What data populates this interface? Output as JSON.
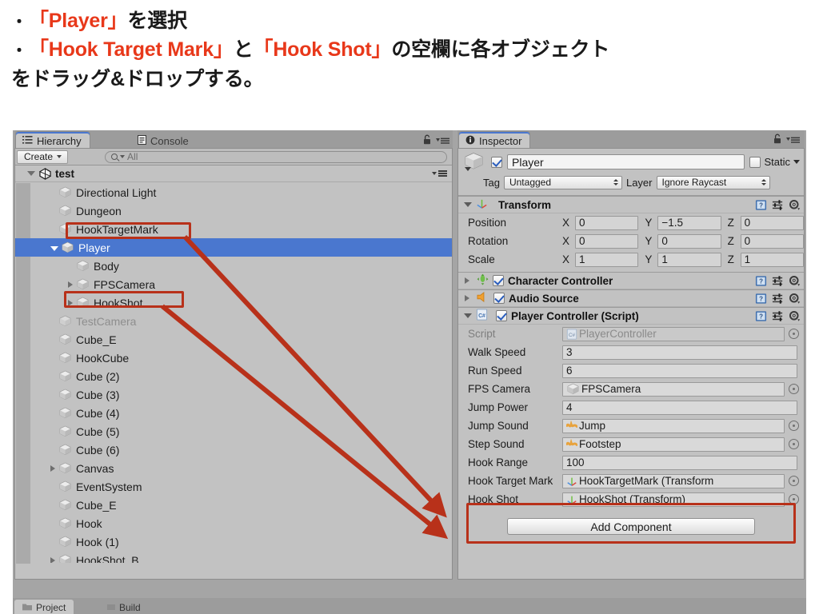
{
  "caption": {
    "line1_bullet": "・",
    "line1_a": "「Player」",
    "line1_b": "を選択",
    "line2_bullet": "・",
    "line2_a": "「Hook Target Mark」",
    "line2_b": "と",
    "line2_c": "「Hook Shot」",
    "line2_d": "の空欄に各オブジェクト",
    "line3": "をドラッグ&ドロップする。",
    "accent_color": "#e8381a"
  },
  "hierarchy": {
    "tabs": [
      {
        "label": "Hierarchy",
        "icon": "list-icon",
        "active": true
      },
      {
        "label": "Console",
        "icon": "console-icon",
        "active": false
      }
    ],
    "toolbar": {
      "create_label": "Create",
      "search_placeholder": "All",
      "search_value": ""
    },
    "scene": {
      "name": "test",
      "expanded": true
    },
    "items": [
      {
        "label": "Directional Light",
        "depth": 1,
        "foldout": "none",
        "selected": false,
        "dim": false,
        "highlight": false
      },
      {
        "label": "Dungeon",
        "depth": 1,
        "foldout": "none",
        "selected": false,
        "dim": false,
        "highlight": false
      },
      {
        "label": "HookTargetMark",
        "depth": 1,
        "foldout": "none",
        "selected": false,
        "dim": false,
        "highlight": true
      },
      {
        "label": "Player",
        "depth": 1,
        "foldout": "open",
        "selected": true,
        "dim": false,
        "highlight": false
      },
      {
        "label": "Body",
        "depth": 2,
        "foldout": "none",
        "selected": false,
        "dim": false,
        "highlight": false
      },
      {
        "label": "FPSCamera",
        "depth": 2,
        "foldout": "closed",
        "selected": false,
        "dim": false,
        "highlight": false
      },
      {
        "label": "HookShot",
        "depth": 2,
        "foldout": "closed",
        "selected": false,
        "dim": false,
        "highlight": true
      },
      {
        "label": "TestCamera",
        "depth": 1,
        "foldout": "none",
        "selected": false,
        "dim": true,
        "highlight": false
      },
      {
        "label": "Cube_E",
        "depth": 1,
        "foldout": "none",
        "selected": false,
        "dim": false,
        "highlight": false
      },
      {
        "label": "HookCube",
        "depth": 1,
        "foldout": "none",
        "selected": false,
        "dim": false,
        "highlight": false
      },
      {
        "label": "Cube (2)",
        "depth": 1,
        "foldout": "none",
        "selected": false,
        "dim": false,
        "highlight": false
      },
      {
        "label": "Cube (3)",
        "depth": 1,
        "foldout": "none",
        "selected": false,
        "dim": false,
        "highlight": false
      },
      {
        "label": "Cube (4)",
        "depth": 1,
        "foldout": "none",
        "selected": false,
        "dim": false,
        "highlight": false
      },
      {
        "label": "Cube (5)",
        "depth": 1,
        "foldout": "none",
        "selected": false,
        "dim": false,
        "highlight": false
      },
      {
        "label": "Cube (6)",
        "depth": 1,
        "foldout": "none",
        "selected": false,
        "dim": false,
        "highlight": false
      },
      {
        "label": "Canvas",
        "depth": 1,
        "foldout": "closed",
        "selected": false,
        "dim": false,
        "highlight": false
      },
      {
        "label": "EventSystem",
        "depth": 1,
        "foldout": "none",
        "selected": false,
        "dim": false,
        "highlight": false
      },
      {
        "label": "Cube_E",
        "depth": 1,
        "foldout": "none",
        "selected": false,
        "dim": false,
        "highlight": false
      },
      {
        "label": "Hook",
        "depth": 1,
        "foldout": "none",
        "selected": false,
        "dim": false,
        "highlight": false
      },
      {
        "label": "Hook (1)",
        "depth": 1,
        "foldout": "none",
        "selected": false,
        "dim": false,
        "highlight": false
      },
      {
        "label": "HookShot_B",
        "depth": 1,
        "foldout": "closed",
        "selected": false,
        "dim": false,
        "highlight": false
      }
    ],
    "selection_color": "#4a77cf"
  },
  "inspector": {
    "tab": {
      "label": "Inspector",
      "icon": "info-icon"
    },
    "object": {
      "enabled": true,
      "name": "Player",
      "static_label": "Static",
      "static_checked": false,
      "tag_label": "Tag",
      "tag_value": "Untagged",
      "layer_label": "Layer",
      "layer_value": "Ignore Raycast"
    },
    "transform": {
      "title": "Transform",
      "expanded": true,
      "rows": [
        {
          "label": "Position",
          "x": "0",
          "y": "−1.5",
          "z": "0"
        },
        {
          "label": "Rotation",
          "x": "0",
          "y": "0",
          "z": "0"
        },
        {
          "label": "Scale",
          "x": "1",
          "y": "1",
          "z": "1"
        }
      ],
      "axis_labels": [
        "X",
        "Y",
        "Z"
      ]
    },
    "components": [
      {
        "title": "Character Controller",
        "icon": "character-controller-icon",
        "expanded": false,
        "enabled": true
      },
      {
        "title": "Audio Source",
        "icon": "audio-source-icon",
        "expanded": false,
        "enabled": true
      }
    ],
    "script_component": {
      "title": "Player Controller (Script)",
      "icon": "csharp-script-icon",
      "expanded": true,
      "enabled": true,
      "fields": [
        {
          "label": "Script",
          "value": "PlayerController",
          "type": "object",
          "icon": "csharp-script-icon",
          "readonly": true,
          "picker": true
        },
        {
          "label": "Walk Speed",
          "value": "3",
          "type": "number",
          "picker": false
        },
        {
          "label": "Run Speed",
          "value": "6",
          "type": "number",
          "picker": false
        },
        {
          "label": "FPS Camera",
          "value": "FPSCamera",
          "type": "object",
          "icon": "gameobject-cube-icon",
          "picker": true
        },
        {
          "label": "Jump Power",
          "value": "4",
          "type": "number",
          "picker": false
        },
        {
          "label": "Jump Sound",
          "value": "Jump",
          "type": "object",
          "icon": "audio-clip-icon",
          "picker": true
        },
        {
          "label": "Step Sound",
          "value": "Footstep",
          "type": "object",
          "icon": "audio-clip-icon",
          "picker": true
        },
        {
          "label": "Hook Range",
          "value": "100",
          "type": "number",
          "picker": false
        },
        {
          "label": "Hook Target Mark",
          "value": "HookTargetMark (Transform",
          "type": "object",
          "icon": "transform-icon",
          "picker": true,
          "highlight": true
        },
        {
          "label": "Hook Shot",
          "value": "HookShot (Transform)",
          "type": "object",
          "icon": "transform-icon",
          "picker": true,
          "highlight": true
        }
      ]
    },
    "add_component_label": "Add Component"
  },
  "bottom_tabs": [
    {
      "label": "Project",
      "active": true
    },
    {
      "label": "Build",
      "active": false
    }
  ],
  "annotations": {
    "box_color": "#b8311a",
    "arrows": [
      {
        "from": "HookTargetMark (hierarchy)",
        "to": "Hook Target Mark field (inspector)"
      },
      {
        "from": "HookShot (hierarchy)",
        "to": "Hook Shot field (inspector)"
      }
    ]
  }
}
